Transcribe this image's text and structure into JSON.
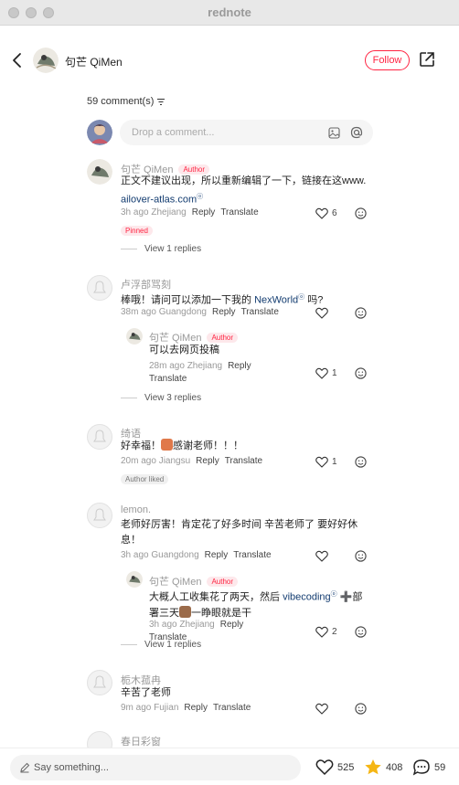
{
  "window": {
    "title": "rednote"
  },
  "header": {
    "author_name": "句芒 QiMen",
    "follow_label": "Follow",
    "back_icon": "chevron-left-icon",
    "share_icon": "share-external-icon"
  },
  "comments_header": {
    "count_label": "59 comment(s)",
    "sort_icon": "sort-icon",
    "input_placeholder": "Drop a comment...",
    "image_icon": "image-icon",
    "mention_icon": "at-mention-icon"
  },
  "author_badge": "Author",
  "comments": [
    {
      "user": "句芒 QiMen",
      "is_author": true,
      "text_main": "正文不建议出现，所以重新编辑了一下，链接在这www.",
      "text_link": "ailover-atlas.com",
      "time": "3h ago",
      "location": "Zhejiang",
      "reply_label": "Reply",
      "translate_label": "Translate",
      "likes": "6",
      "tag": "Pinned",
      "view_replies": "View 1 replies"
    },
    {
      "user": "卢浮部骂刻",
      "text_main": "棒哦！请问可以添加一下我的",
      "text_link": "NexWorld",
      "text_after": "吗?",
      "time": "38m ago",
      "location": "Guangdong",
      "reply_label": "Reply",
      "translate_label": "Translate",
      "likes": "",
      "reply": {
        "user": "句芒 QiMen",
        "is_author": true,
        "text": "可以去网页投稿",
        "time": "28m ago",
        "location": "Zhejiang",
        "reply_label": "Reply",
        "translate_label": "Translate",
        "likes": "1"
      },
      "view_replies": "View 3 replies"
    },
    {
      "user": "绮语",
      "text_before": "好幸福！",
      "text_after": "感谢老师！！！",
      "time": "20m ago",
      "location": "Jiangsu",
      "reply_label": "Reply",
      "translate_label": "Translate",
      "likes": "1",
      "tag": "Author liked"
    },
    {
      "user": "lemon.",
      "text_main": "老师好厉害！肯定花了好多时间 辛苦老师了 要好好休息！",
      "time": "3h ago",
      "location": "Guangdong",
      "reply_label": "Reply",
      "translate_label": "Translate",
      "likes": "",
      "reply": {
        "user": "句芒 QiMen",
        "is_author": true,
        "text_before": "大概人工收集花了两天，然后",
        "text_link": "vibecoding",
        "text_mid": "➕部署三天",
        "text_after": "一睁眼就是干",
        "time": "3h ago",
        "location": "Zhejiang",
        "reply_label": "Reply",
        "translate_label": "Translate",
        "likes": "2"
      },
      "view_replies": "View 1 replies"
    },
    {
      "user": "栀木菰冉",
      "text_main": "辛苦了老师",
      "time": "9m ago",
      "location": "Fujian",
      "reply_label": "Reply",
      "translate_label": "Translate",
      "likes": ""
    },
    {
      "user": "春日彩窗"
    }
  ],
  "bottom_bar": {
    "input_placeholder": "Say something...",
    "likes": "525",
    "stars": "408",
    "comments": "59",
    "like_icon": "heart-icon",
    "star_icon": "star-icon",
    "comment_icon": "comment-bubble-icon",
    "star_color": "#f5b614"
  },
  "colors": {
    "accent": "#ff2442",
    "link": "#133c70"
  }
}
